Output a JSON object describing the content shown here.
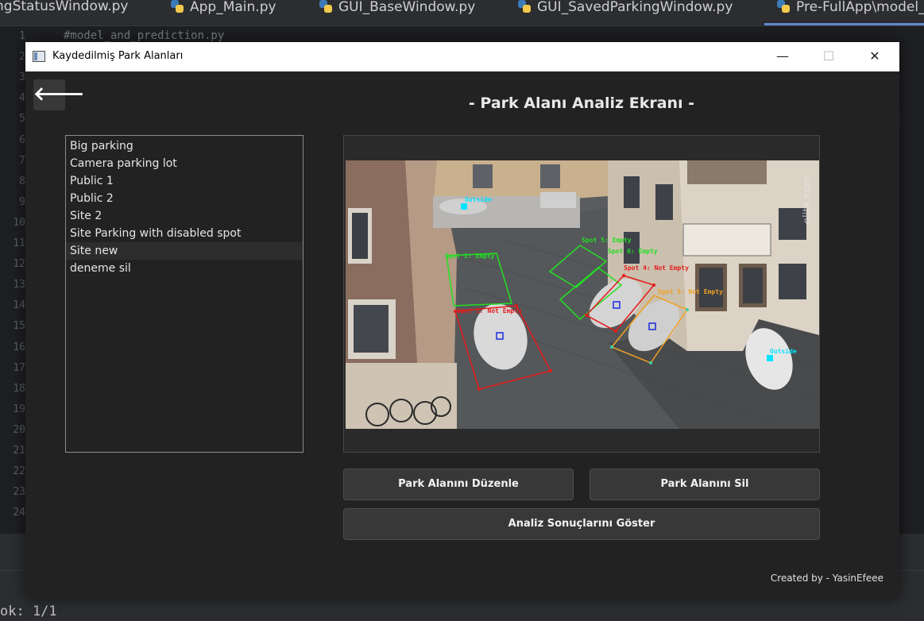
{
  "ide": {
    "tabs": [
      "ngStatusWindow.py",
      "App_Main.py",
      "GUI_BaseWindow.py",
      "GUI_SavedParkingWindow.py",
      "Pre-FullApp\\model_"
    ],
    "line_numbers": [
      "1",
      "2",
      "3",
      "4",
      "5",
      "6",
      "7",
      "8",
      "9",
      "10",
      "11",
      "12",
      "13",
      "14",
      "15",
      "16",
      "17",
      "18",
      "19",
      "20",
      "21",
      "22",
      "23",
      "24"
    ],
    "code_line": "#model_and_prediction.py",
    "terminal_text": "ok: 1/1"
  },
  "window": {
    "title": "Kaydedilmiş Park Alanları",
    "minimize": "—",
    "maximize": "☐",
    "close": "✕"
  },
  "back_button": {
    "icon": "arrow-left-icon",
    "glyph": "🡐"
  },
  "page_title": "- Park Alanı Analiz Ekranı -",
  "parking_list": {
    "items": [
      {
        "label": "Big parking",
        "selected": false
      },
      {
        "label": "Camera parking lot",
        "selected": false
      },
      {
        "label": "Public 1",
        "selected": false
      },
      {
        "label": "Public 2",
        "selected": false
      },
      {
        "label": "Site 2",
        "selected": false
      },
      {
        "label": "Site Parking with disabled spot",
        "selected": false
      },
      {
        "label": "Site new",
        "selected": true
      },
      {
        "label": "deneme sil",
        "selected": false
      }
    ]
  },
  "preview": {
    "annotations": [
      {
        "label": "Spot 2: Empty",
        "status": "empty"
      },
      {
        "label": "Spot 5: Empty",
        "status": "empty"
      },
      {
        "label": "Spot 6: Empty",
        "status": "empty"
      },
      {
        "label": "Spot 4: Not Empty",
        "status": "occupied"
      },
      {
        "label": "Spot 3: Not Empty",
        "status": "occupied-orange"
      },
      {
        "label": "Spot 1: Not Empty",
        "status": "occupied"
      },
      {
        "label": "Outside",
        "status": "outside"
      },
      {
        "label": "Outside",
        "status": "outside"
      }
    ],
    "watermark": "elite.com",
    "colors": {
      "empty": "#22e022",
      "occupied": "#e41a1a",
      "orange": "#f0a020",
      "outside": "#00e5ff"
    }
  },
  "buttons": {
    "edit": "Park Alanını Düzenle",
    "delete": "Park Alanını Sil",
    "results": "Analiz Sonuçlarını Göster"
  },
  "credit": "Created by - YasinEfeee"
}
